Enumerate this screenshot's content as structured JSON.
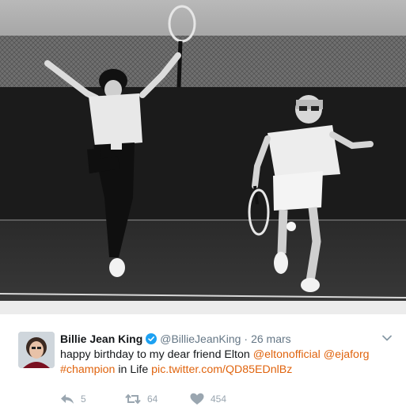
{
  "tweet": {
    "author_name": "Billie Jean King",
    "handle": "@BillieJeanKing",
    "separator": "·",
    "timestamp": "26 mars",
    "text_parts": {
      "t1": "happy birthday to my dear friend Elton ",
      "mention1": "@eltonofficial",
      "t2": " ",
      "mention2": "@ejaforg",
      "hashtag": "#champion",
      "t3": " in Life ",
      "pic_link": "pic.twitter.com/QD85EDnlBz"
    },
    "counts": {
      "replies": "5",
      "retweets": "64",
      "likes": "454"
    }
  },
  "colors": {
    "link": "#e0640e",
    "name": "#14171a",
    "muted": "#657786",
    "action": "#9aa6b0",
    "verified": "#1da1f2"
  },
  "icons": {
    "reply": "reply-icon",
    "retweet": "retweet-icon",
    "like": "heart-icon",
    "verified": "verified-badge-icon",
    "more": "chevron-down-icon"
  }
}
